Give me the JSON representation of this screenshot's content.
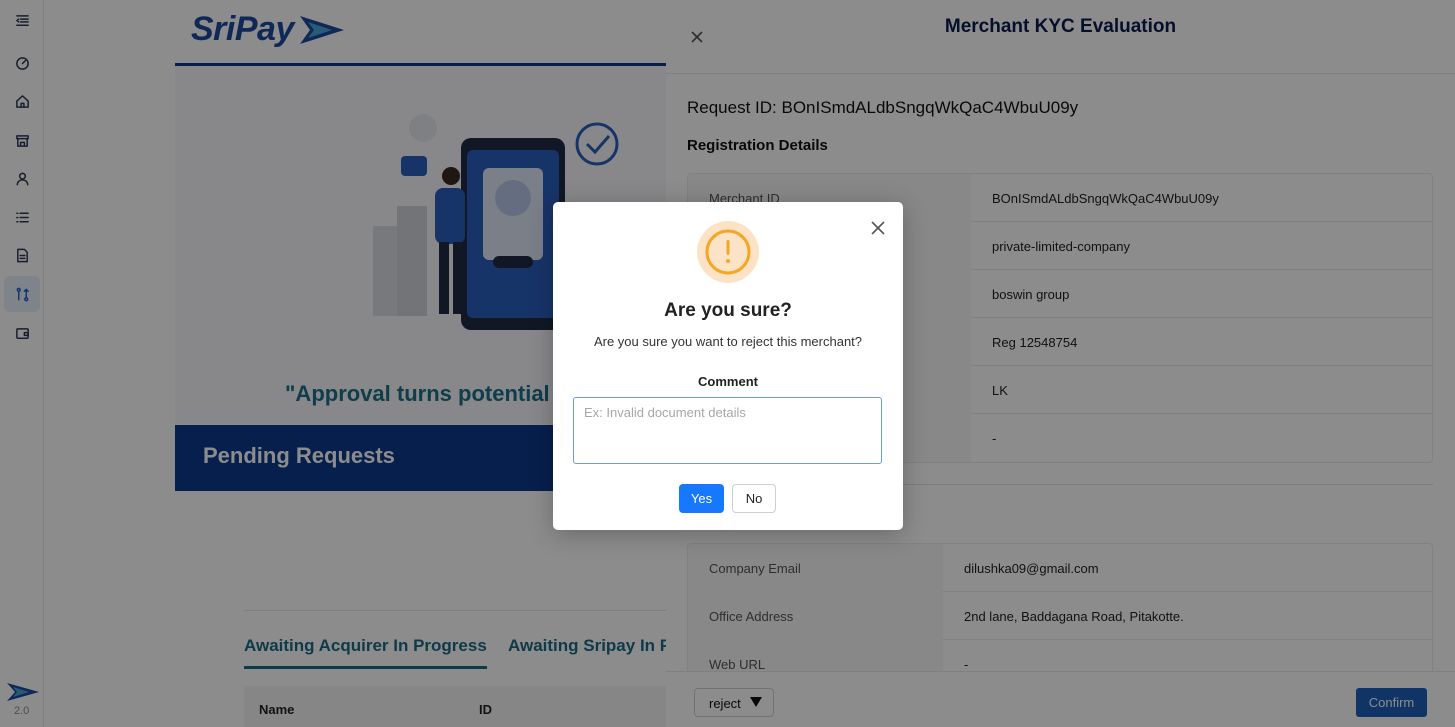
{
  "app": {
    "brand": "SriPay",
    "version": "2.0"
  },
  "rail": {
    "items": [
      {
        "icon": "menu-collapse-icon"
      },
      {
        "icon": "dashboard-icon"
      },
      {
        "icon": "home-icon"
      },
      {
        "icon": "store-icon"
      },
      {
        "icon": "user-icon"
      },
      {
        "icon": "list-icon"
      },
      {
        "icon": "document-icon"
      },
      {
        "icon": "requests-icon",
        "active": true
      },
      {
        "icon": "wallet-icon"
      }
    ]
  },
  "hero": {
    "quote": "\"Approval turns potential"
  },
  "pending": {
    "title": "Pending Requests",
    "tabs": [
      "Awaiting Acquirer In Progress",
      "Awaiting Sripay In P"
    ],
    "columns": [
      "Name",
      "ID"
    ]
  },
  "drawer": {
    "title": "Merchant KYC Evaluation",
    "request_id": "Request ID: BOnISmdALdbSngqWkQaC4WbuU09y",
    "registration_heading": "Registration Details",
    "registration_rows": [
      {
        "key": "Merchant ID",
        "value": "BOnISmdALdbSngqWkQaC4WbuU09y"
      },
      {
        "key": "",
        "value": "private-limited-company"
      },
      {
        "key": "",
        "value": "boswin group"
      },
      {
        "key": "",
        "value": "Reg 12548754"
      },
      {
        "key": "",
        "value": "LK"
      },
      {
        "key": "",
        "value": "-"
      }
    ],
    "contact_rows": [
      {
        "key": "Company Email",
        "value": "dilushka09@gmail.com"
      },
      {
        "key": "Office Address",
        "value": "2nd lane, Baddagana Road, Pitakotte."
      },
      {
        "key": "Web URL",
        "value": "-"
      }
    ],
    "action_select_value": "reject",
    "confirm_label": "Confirm"
  },
  "modal": {
    "title": "Are you sure?",
    "message": "Are you sure you want to reject this merchant?",
    "comment_label": "Comment",
    "comment_placeholder": "Ex: Invalid document details",
    "comment_value": "",
    "yes_label": "Yes",
    "no_label": "No",
    "accent": "#f5a623"
  },
  "colors": {
    "primary": "#1677ff",
    "brand_navy": "#0b3a8c",
    "teal_text": "#1d6b86"
  }
}
